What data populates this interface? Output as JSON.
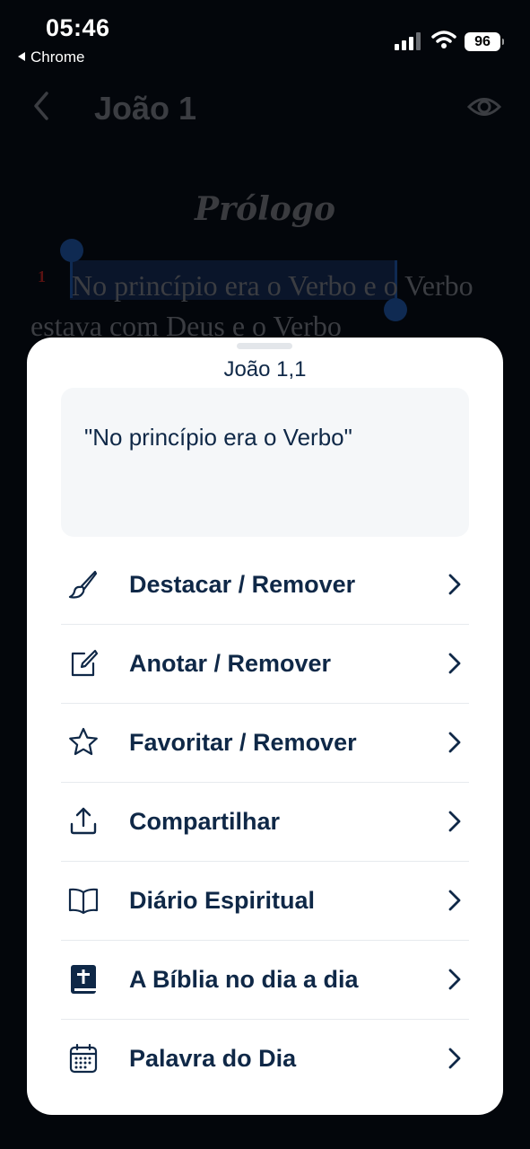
{
  "status_bar": {
    "time": "05:46",
    "back_app": "Chrome",
    "battery": "96"
  },
  "header": {
    "title": "João 1"
  },
  "reader": {
    "section_heading": "Prólogo",
    "verse_number": "1",
    "verse_text": "No princípio era o Verbo e o Verbo estava com Deus e o Verbo"
  },
  "sheet": {
    "reference": "João 1,1",
    "quote": "\"No princípio era o Verbo\"",
    "actions": [
      {
        "label": "Destacar / Remover",
        "icon": "brush-icon"
      },
      {
        "label": "Anotar / Remover",
        "icon": "edit-note-icon"
      },
      {
        "label": "Favoritar / Remover",
        "icon": "star-icon"
      },
      {
        "label": "Compartilhar",
        "icon": "share-icon"
      },
      {
        "label": "Diário Espiritual",
        "icon": "open-book-icon"
      },
      {
        "label": "A Bíblia no dia a dia",
        "icon": "bible-icon"
      },
      {
        "label": "Palavra do Dia",
        "icon": "calendar-icon"
      }
    ]
  },
  "colors": {
    "primary": "#0f2847",
    "background": "#03060b",
    "sheet": "#ffffff",
    "quote_box": "#f5f7f9"
  }
}
